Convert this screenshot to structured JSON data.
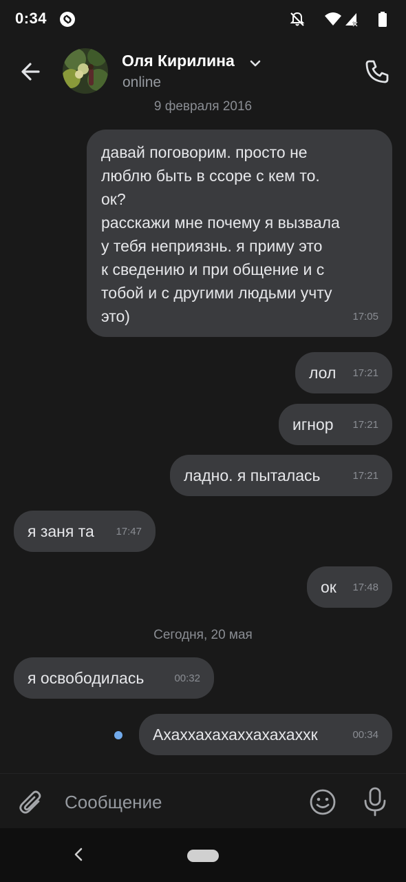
{
  "status_bar": {
    "time": "0:34"
  },
  "header": {
    "contact_name": "Оля Кирилина",
    "contact_status": "online"
  },
  "chat": {
    "date_1": "9 февраля 2016",
    "date_2": "Сегодня, 20 мая",
    "messages": [
      {
        "direction": "out",
        "text": "давай поговорим. просто не\nлюблю быть в ссоре с кем то.\nок?\nрасскажи мне почему я вызвала\nу тебя неприязнь. я приму это\nк сведению и при общение и с\nтобой и с другими людьми учту\nэто)",
        "time": "17:05"
      },
      {
        "direction": "out",
        "text": "лол",
        "time": "17:21"
      },
      {
        "direction": "out",
        "text": "игнор",
        "time": "17:21"
      },
      {
        "direction": "out",
        "text": "ладно. я пыталась",
        "time": "17:21"
      },
      {
        "direction": "in",
        "text": "я заня та",
        "time": "17:47"
      },
      {
        "direction": "out",
        "text": "ок",
        "time": "17:48"
      },
      {
        "direction": "in",
        "text": "я освободилась",
        "time": "00:32"
      },
      {
        "direction": "out",
        "text": "Ахаххахахаххахахаххк",
        "time": "00:34",
        "unread": true
      }
    ]
  },
  "composer": {
    "placeholder": "Сообщение"
  },
  "icons": {
    "back": "arrow-left-icon",
    "call": "phone-icon",
    "name_dropdown": "chevron-down-icon",
    "attach": "paperclip-icon",
    "emoji": "smile-icon",
    "mic": "microphone-icon"
  },
  "colors": {
    "background": "#191919",
    "bubble": "#3a3b3e",
    "accent_dot": "#71aaeb",
    "secondary_text": "#969aa0"
  }
}
